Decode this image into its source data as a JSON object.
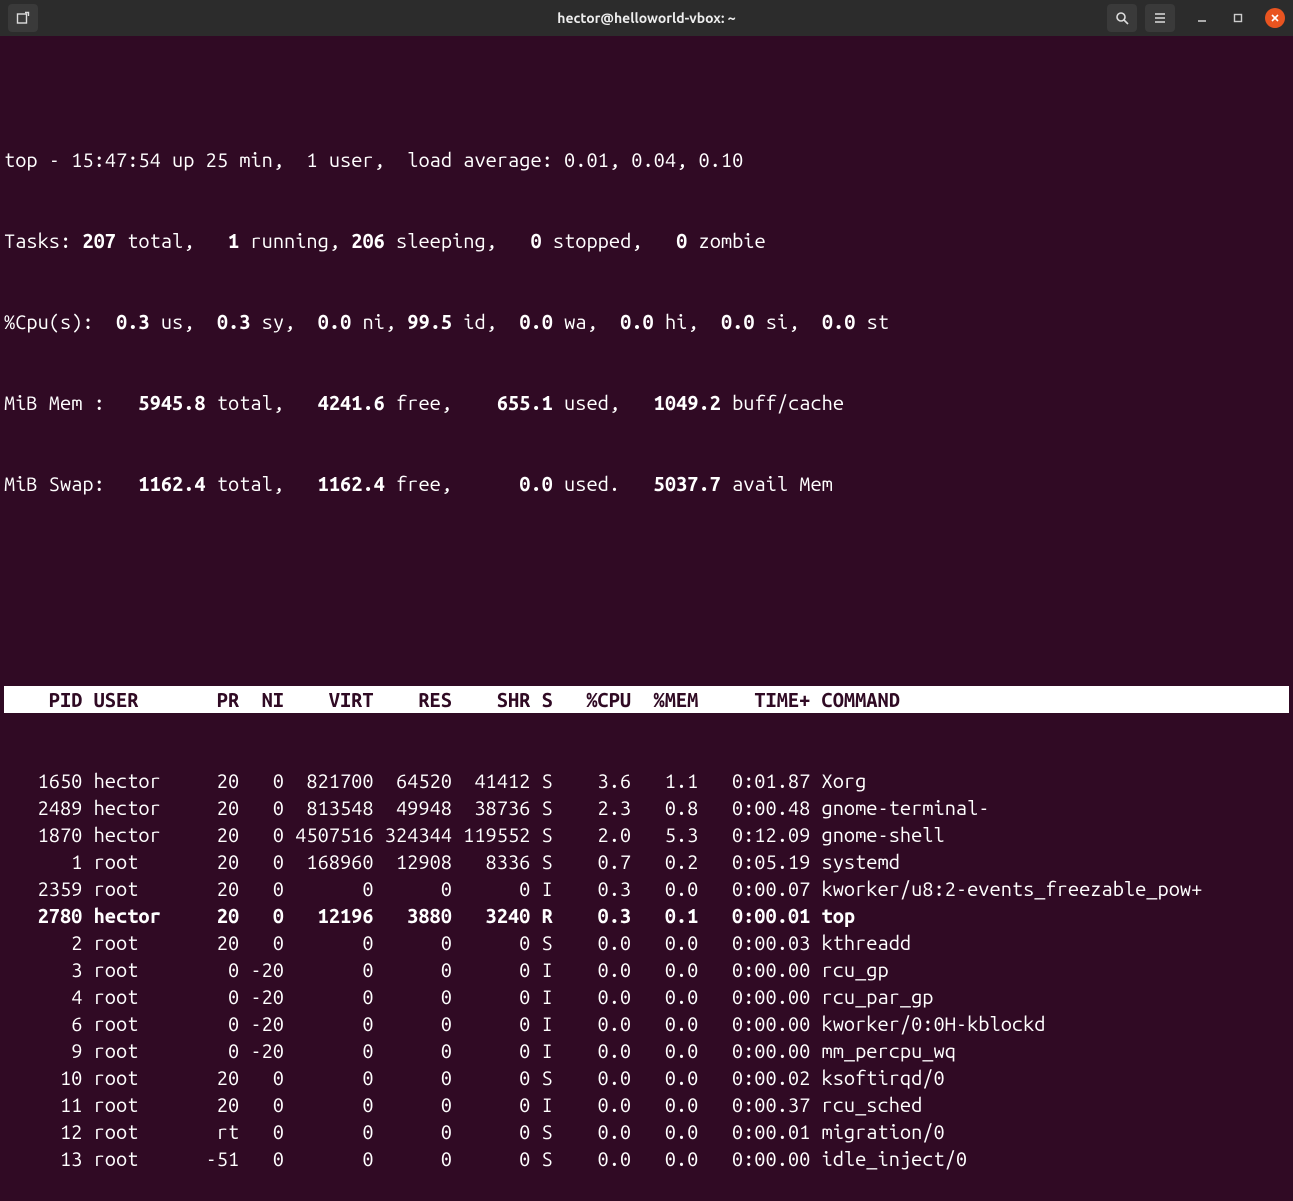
{
  "window": {
    "title": "hector@helloworld-vbox: ~"
  },
  "top": {
    "uptime_line": {
      "prefix": "top - ",
      "time": "15:47:54",
      "up_label": " up ",
      "uptime": "25 min,",
      "users": "  1 user,",
      "la_label": "  load average: ",
      "la1": "0.01",
      "la2": "0.04",
      "la3": "0.10"
    },
    "tasks": {
      "label": "Tasks:",
      "total": "207",
      "total_label": " total,",
      "running": "1",
      "running_label": " running,",
      "sleeping": "206",
      "sleeping_label": " sleeping,",
      "stopped": "0",
      "stopped_label": " stopped,",
      "zombie": "0",
      "zombie_label": " zombie"
    },
    "cpu": {
      "label": "%Cpu(s):",
      "us": "0.3",
      "us_label": " us,",
      "sy": "0.3",
      "sy_label": " sy,",
      "ni": "0.0",
      "ni_label": " ni,",
      "id": "99.5",
      "id_label": " id,",
      "wa": "0.0",
      "wa_label": " wa,",
      "hi": "0.0",
      "hi_label": " hi,",
      "si": "0.0",
      "si_label": " si,",
      "st": "0.0",
      "st_label": " st"
    },
    "mem": {
      "label": "MiB Mem :",
      "total": "5945.8",
      "total_label": " total,",
      "free": "4241.6",
      "free_label": " free,",
      "used": "655.1",
      "used_label": " used,",
      "buff": "1049.2",
      "buff_label": " buff/cache"
    },
    "swap": {
      "label": "MiB Swap:",
      "total": "1162.4",
      "total_label": " total,",
      "free": "1162.4",
      "free_label": " free,",
      "used": "0.0",
      "used_label": " used.",
      "avail": "5037.7",
      "avail_label": " avail Mem"
    },
    "columns": {
      "pid": "PID",
      "user": "USER",
      "pr": "PR",
      "ni": "NI",
      "virt": "VIRT",
      "res": "RES",
      "shr": "SHR",
      "s": "S",
      "cpu": "%CPU",
      "mem": "%MEM",
      "time": "TIME+",
      "cmd": "COMMAND"
    },
    "processes": [
      {
        "pid": "1650",
        "user": "hector",
        "pr": "20",
        "ni": "0",
        "virt": "821700",
        "res": "64520",
        "shr": "41412",
        "s": "S",
        "cpu": "3.6",
        "mem": "1.1",
        "time": "0:01.87",
        "cmd": "Xorg",
        "self": false
      },
      {
        "pid": "2489",
        "user": "hector",
        "pr": "20",
        "ni": "0",
        "virt": "813548",
        "res": "49948",
        "shr": "38736",
        "s": "S",
        "cpu": "2.3",
        "mem": "0.8",
        "time": "0:00.48",
        "cmd": "gnome-terminal-",
        "self": false
      },
      {
        "pid": "1870",
        "user": "hector",
        "pr": "20",
        "ni": "0",
        "virt": "4507516",
        "res": "324344",
        "shr": "119552",
        "s": "S",
        "cpu": "2.0",
        "mem": "5.3",
        "time": "0:12.09",
        "cmd": "gnome-shell",
        "self": false
      },
      {
        "pid": "1",
        "user": "root",
        "pr": "20",
        "ni": "0",
        "virt": "168960",
        "res": "12908",
        "shr": "8336",
        "s": "S",
        "cpu": "0.7",
        "mem": "0.2",
        "time": "0:05.19",
        "cmd": "systemd",
        "self": false
      },
      {
        "pid": "2359",
        "user": "root",
        "pr": "20",
        "ni": "0",
        "virt": "0",
        "res": "0",
        "shr": "0",
        "s": "I",
        "cpu": "0.3",
        "mem": "0.0",
        "time": "0:00.07",
        "cmd": "kworker/u8:2-events_freezable_pow+",
        "self": false
      },
      {
        "pid": "2780",
        "user": "hector",
        "pr": "20",
        "ni": "0",
        "virt": "12196",
        "res": "3880",
        "shr": "3240",
        "s": "R",
        "cpu": "0.3",
        "mem": "0.1",
        "time": "0:00.01",
        "cmd": "top",
        "self": true
      },
      {
        "pid": "2",
        "user": "root",
        "pr": "20",
        "ni": "0",
        "virt": "0",
        "res": "0",
        "shr": "0",
        "s": "S",
        "cpu": "0.0",
        "mem": "0.0",
        "time": "0:00.03",
        "cmd": "kthreadd",
        "self": false
      },
      {
        "pid": "3",
        "user": "root",
        "pr": "0",
        "ni": "-20",
        "virt": "0",
        "res": "0",
        "shr": "0",
        "s": "I",
        "cpu": "0.0",
        "mem": "0.0",
        "time": "0:00.00",
        "cmd": "rcu_gp",
        "self": false
      },
      {
        "pid": "4",
        "user": "root",
        "pr": "0",
        "ni": "-20",
        "virt": "0",
        "res": "0",
        "shr": "0",
        "s": "I",
        "cpu": "0.0",
        "mem": "0.0",
        "time": "0:00.00",
        "cmd": "rcu_par_gp",
        "self": false
      },
      {
        "pid": "6",
        "user": "root",
        "pr": "0",
        "ni": "-20",
        "virt": "0",
        "res": "0",
        "shr": "0",
        "s": "I",
        "cpu": "0.0",
        "mem": "0.0",
        "time": "0:00.00",
        "cmd": "kworker/0:0H-kblockd",
        "self": false
      },
      {
        "pid": "9",
        "user": "root",
        "pr": "0",
        "ni": "-20",
        "virt": "0",
        "res": "0",
        "shr": "0",
        "s": "I",
        "cpu": "0.0",
        "mem": "0.0",
        "time": "0:00.00",
        "cmd": "mm_percpu_wq",
        "self": false
      },
      {
        "pid": "10",
        "user": "root",
        "pr": "20",
        "ni": "0",
        "virt": "0",
        "res": "0",
        "shr": "0",
        "s": "S",
        "cpu": "0.0",
        "mem": "0.0",
        "time": "0:00.02",
        "cmd": "ksoftirqd/0",
        "self": false
      },
      {
        "pid": "11",
        "user": "root",
        "pr": "20",
        "ni": "0",
        "virt": "0",
        "res": "0",
        "shr": "0",
        "s": "I",
        "cpu": "0.0",
        "mem": "0.0",
        "time": "0:00.37",
        "cmd": "rcu_sched",
        "self": false
      },
      {
        "pid": "12",
        "user": "root",
        "pr": "rt",
        "ni": "0",
        "virt": "0",
        "res": "0",
        "shr": "0",
        "s": "S",
        "cpu": "0.0",
        "mem": "0.0",
        "time": "0:00.01",
        "cmd": "migration/0",
        "self": false
      },
      {
        "pid": "13",
        "user": "root",
        "pr": "-51",
        "ni": "0",
        "virt": "0",
        "res": "0",
        "shr": "0",
        "s": "S",
        "cpu": "0.0",
        "mem": "0.0",
        "time": "0:00.00",
        "cmd": "idle_inject/0",
        "self": false
      }
    ]
  }
}
